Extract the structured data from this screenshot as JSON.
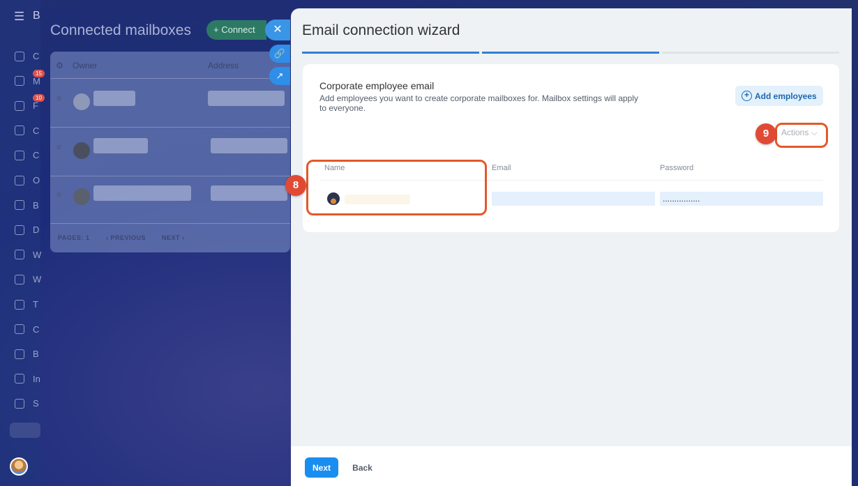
{
  "app": {
    "brand": "B"
  },
  "rail": {
    "items": [
      {
        "letter": "C",
        "badge": ""
      },
      {
        "letter": "M",
        "badge": "15"
      },
      {
        "letter": "F",
        "badge": "10"
      },
      {
        "letter": "C",
        "badge": ""
      },
      {
        "letter": "C",
        "badge": ""
      },
      {
        "letter": "O",
        "badge": ""
      },
      {
        "letter": "B",
        "badge": ""
      },
      {
        "letter": "D",
        "badge": ""
      },
      {
        "letter": "W",
        "badge": ""
      },
      {
        "letter": "W",
        "badge": ""
      },
      {
        "letter": "T",
        "badge": ""
      },
      {
        "letter": "C",
        "badge": ""
      },
      {
        "letter": "B",
        "badge": ""
      },
      {
        "letter": "In",
        "badge": ""
      },
      {
        "letter": "S",
        "badge": ""
      }
    ]
  },
  "background_page": {
    "title": "Connected mailboxes",
    "connect_label": "+ Connect",
    "columns": {
      "owner": "Owner",
      "address": "Address"
    },
    "pagination": {
      "pages_label": "PAGES:",
      "page": "1",
      "previous": "PREVIOUS",
      "next": "NEXT"
    }
  },
  "side_buttons": {
    "close": "✕",
    "link": "🔗",
    "open": "↗"
  },
  "wizard": {
    "title": "Email connection wizard",
    "steps": [
      {
        "state": "done"
      },
      {
        "state": "current"
      },
      {
        "state": "pending"
      }
    ],
    "colors": {
      "step_active": "#2f7fd6",
      "step_pending": "#dfe3e7",
      "accent": "#1a8ef0",
      "marker": "#e04a35"
    },
    "section": {
      "title": "Corporate employee email",
      "description": "Add employees you want to create corporate mailboxes for. Mailbox settings will apply to everyone.",
      "add_button": "Add employees",
      "actions_label": "Actions",
      "columns": {
        "name": "Name",
        "email": "Email",
        "password": "Password"
      },
      "row": {
        "email": "",
        "password": "................"
      }
    },
    "annotations": {
      "name_marker": "8",
      "actions_marker": "9"
    },
    "footer": {
      "next": "Next",
      "back": "Back"
    }
  }
}
